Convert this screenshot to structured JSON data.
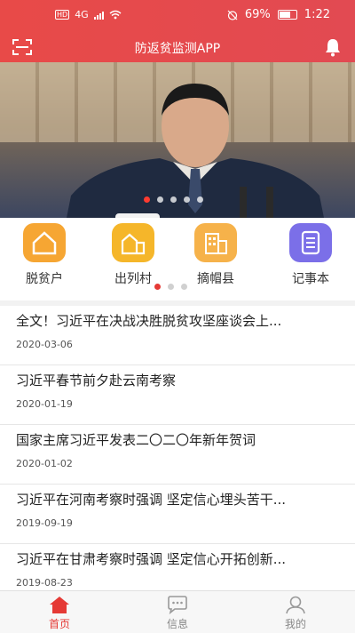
{
  "status": {
    "network": "4G",
    "battery": "69%",
    "time": "1:22"
  },
  "header": {
    "title": "防返贫监测APP"
  },
  "banner": {
    "slides": 5,
    "active": 0
  },
  "grid": {
    "items": [
      {
        "label": "脱贫户",
        "icon": "house-icon",
        "color": "#f6a633"
      },
      {
        "label": "出列村",
        "icon": "village-icon",
        "color": "#f5b62a"
      },
      {
        "label": "摘帽县",
        "icon": "building-icon",
        "color": "#f6b24a"
      },
      {
        "label": "记事本",
        "icon": "notebook-icon",
        "color": "#7b6fe8"
      }
    ],
    "pages": 3,
    "active_page": 0
  },
  "news": [
    {
      "title": "全文！习近平在决战决胜脱贫攻坚座谈会上...",
      "date": "2020-03-06"
    },
    {
      "title": "习近平春节前夕赴云南考察",
      "date": "2020-01-19"
    },
    {
      "title": "国家主席习近平发表二〇二〇年新年贺词",
      "date": "2020-01-02"
    },
    {
      "title": "习近平在河南考察时强调 坚定信心埋头苦干...",
      "date": "2019-09-19"
    },
    {
      "title": "习近平在甘肃考察时强调 坚定信心开拓创新...",
      "date": "2019-08-23"
    }
  ],
  "tabbar": [
    {
      "label": "首页",
      "icon": "home-icon",
      "active": true
    },
    {
      "label": "信息",
      "icon": "message-icon",
      "active": false
    },
    {
      "label": "我的",
      "icon": "profile-icon",
      "active": false
    }
  ],
  "colors": {
    "accent": "#e53935",
    "header": "#e84a48"
  }
}
